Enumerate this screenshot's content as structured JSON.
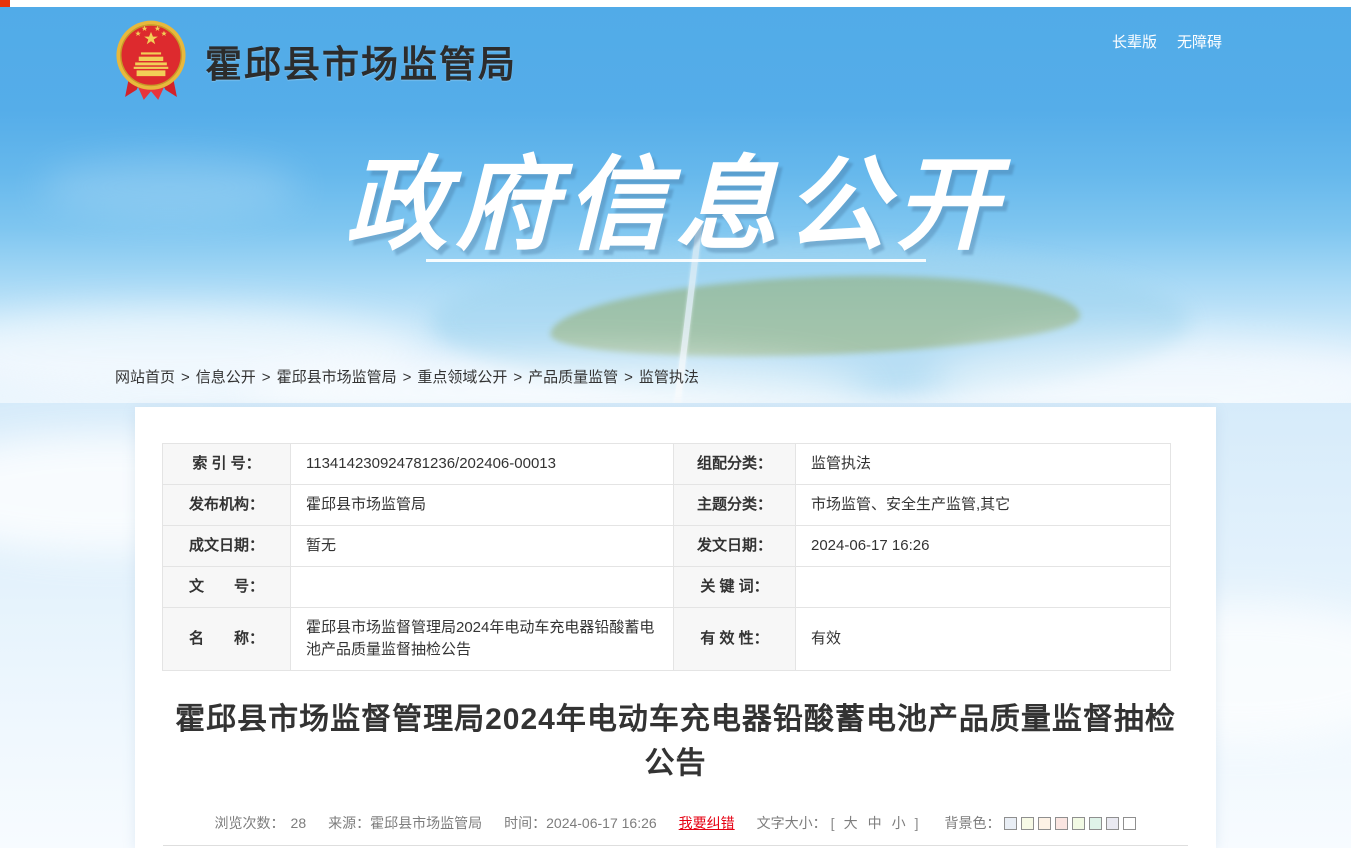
{
  "colors": {
    "banner_blue": "#55ade9",
    "correction_red": "#e60012",
    "label_cell_bg": "#f7f7f7"
  },
  "header": {
    "site_name": "霍邱县市场监管局",
    "elder_link": "长辈版",
    "accessibility_link": "无障碍"
  },
  "banner": {
    "title": "政府信息公开"
  },
  "breadcrumb": {
    "separator": ">",
    "items": [
      "网站首页",
      "信息公开",
      "霍邱县市场监管局",
      "重点领域公开",
      "产品质量监管",
      "监管执法"
    ]
  },
  "info_table": {
    "rows": [
      {
        "l1": "索 引 号：",
        "v1": "113414230924781236/202406-00013",
        "l2": "组配分类：",
        "v2": "监管执法"
      },
      {
        "l1": "发布机构：",
        "v1": "霍邱县市场监管局",
        "l2": "主题分类：",
        "v2": "市场监管、安全生产监管,其它"
      },
      {
        "l1": "成文日期：",
        "v1": "暂无",
        "l2": "发文日期：",
        "v2": "2024-06-17 16:26"
      },
      {
        "l1": "文　　号：",
        "v1": "",
        "l2": "关 键 词：",
        "v2": ""
      },
      {
        "l1": "名　　称：",
        "v1": "霍邱县市场监督管理局2024年电动车充电器铅酸蓄电池产品质量监督抽检公告",
        "l2": "有 效 性：",
        "v2": "有效"
      }
    ]
  },
  "article": {
    "title": "霍邱县市场监督管理局2024年电动车充电器铅酸蓄电池产品质量监督抽检公告"
  },
  "meta": {
    "views_label": "浏览次数：",
    "views_value": "28",
    "source_label": "来源：霍邱县市场监管局",
    "time_label": "时间：2024-06-17 16:26",
    "correction_link": "我要纠错",
    "font_size_label": "文字大小：",
    "bracket_open": "[",
    "bracket_close": "]",
    "font_sizes": [
      "大",
      "中",
      "小"
    ],
    "bg_label": "背景色：",
    "bg_colors": [
      "#e9eef5",
      "#f7fae6",
      "#fdf2e6",
      "#fae5e1",
      "#f2fae4",
      "#dff3e9",
      "#e9e9f1",
      "#ffffff"
    ]
  }
}
